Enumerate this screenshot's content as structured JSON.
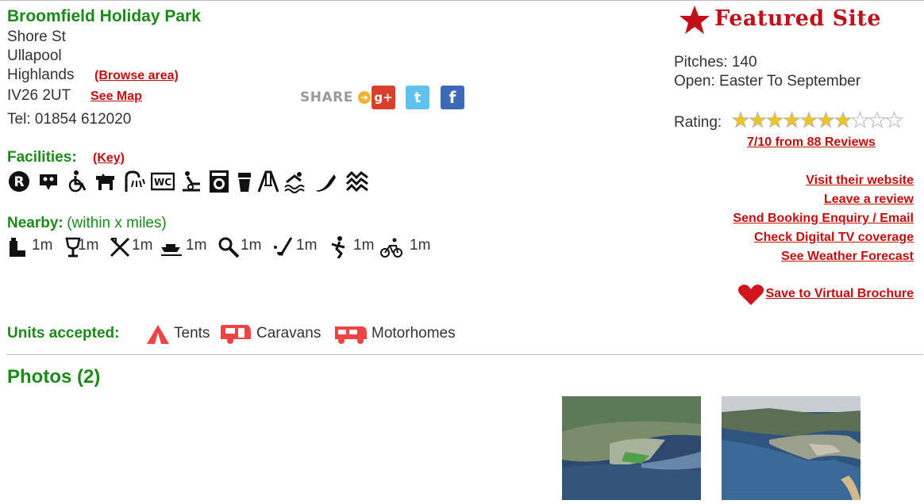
{
  "park": {
    "name": "Broomfield Holiday Park",
    "address": [
      "Shore St",
      "Ullapool",
      "Highlands",
      "IV26 2UT"
    ],
    "browse_area": "(Browse area)",
    "see_map": "See Map",
    "tel": "Tel: 01854 612020"
  },
  "share": {
    "label": "SHARE",
    "google_plus": "g+",
    "twitter": "t",
    "facebook": "f"
  },
  "facilities": {
    "label": "Facilities:",
    "key_link": "(Key)",
    "icons": [
      "registered-icon",
      "dog-face-icon",
      "wheelchair-icon",
      "dog-icon",
      "shower-icon",
      "wc-icon",
      "baby-change-icon",
      "washing-machine-icon",
      "bin-icon",
      "playground-icon",
      "swimming-icon",
      "fishing-icon",
      "water-icon"
    ]
  },
  "nearby": {
    "label": "Nearby:",
    "note": "(within x miles)",
    "items": [
      {
        "icon": "pub-icon",
        "value": "1m"
      },
      {
        "icon": "wine-glass-icon",
        "value": "1m"
      },
      {
        "icon": "restaurant-icon",
        "value": "1m"
      },
      {
        "icon": "boat-icon",
        "value": "1m"
      },
      {
        "icon": "search-icon",
        "value": "1m"
      },
      {
        "icon": "golf-icon",
        "value": "1m"
      },
      {
        "icon": "walking-icon",
        "value": "1m"
      },
      {
        "icon": "cycling-icon",
        "value": "1m"
      }
    ]
  },
  "featured": {
    "label": "Featured Site"
  },
  "info": {
    "pitches": "Pitches: 140",
    "open": "Open: Easter To September",
    "rating_label": "Rating:",
    "rating_value": 7,
    "rating_max": 10,
    "reviews_link": "7/10 from 88 Reviews"
  },
  "actions": {
    "visit_website": "Visit their website",
    "leave_review": "Leave a review",
    "send_enquiry": "Send Booking Enquiry / Email",
    "check_tv": "Check Digital TV coverage",
    "weather": "See Weather Forecast",
    "save_brochure": "Save to Virtual Brochure"
  },
  "units": {
    "label": "Units accepted:",
    "items": [
      "Tents",
      "Caravans",
      "Motorhomes"
    ]
  },
  "photos": {
    "title": "Photos (2)"
  },
  "colors": {
    "accent_green": "#1a8a1a",
    "link_red": "#c40c0c",
    "star_gold": "#f0c419"
  }
}
